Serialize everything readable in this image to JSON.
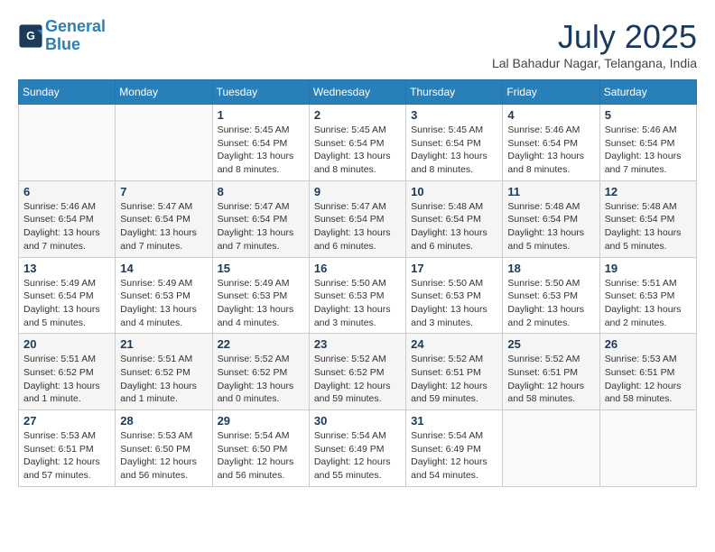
{
  "header": {
    "logo_line1": "General",
    "logo_line2": "Blue",
    "month_title": "July 2025",
    "location": "Lal Bahadur Nagar, Telangana, India"
  },
  "weekdays": [
    "Sunday",
    "Monday",
    "Tuesday",
    "Wednesday",
    "Thursday",
    "Friday",
    "Saturday"
  ],
  "weeks": [
    [
      {
        "day": "",
        "info": ""
      },
      {
        "day": "",
        "info": ""
      },
      {
        "day": "1",
        "info": "Sunrise: 5:45 AM\nSunset: 6:54 PM\nDaylight: 13 hours\nand 8 minutes."
      },
      {
        "day": "2",
        "info": "Sunrise: 5:45 AM\nSunset: 6:54 PM\nDaylight: 13 hours\nand 8 minutes."
      },
      {
        "day": "3",
        "info": "Sunrise: 5:45 AM\nSunset: 6:54 PM\nDaylight: 13 hours\nand 8 minutes."
      },
      {
        "day": "4",
        "info": "Sunrise: 5:46 AM\nSunset: 6:54 PM\nDaylight: 13 hours\nand 8 minutes."
      },
      {
        "day": "5",
        "info": "Sunrise: 5:46 AM\nSunset: 6:54 PM\nDaylight: 13 hours\nand 7 minutes."
      }
    ],
    [
      {
        "day": "6",
        "info": "Sunrise: 5:46 AM\nSunset: 6:54 PM\nDaylight: 13 hours\nand 7 minutes."
      },
      {
        "day": "7",
        "info": "Sunrise: 5:47 AM\nSunset: 6:54 PM\nDaylight: 13 hours\nand 7 minutes."
      },
      {
        "day": "8",
        "info": "Sunrise: 5:47 AM\nSunset: 6:54 PM\nDaylight: 13 hours\nand 7 minutes."
      },
      {
        "day": "9",
        "info": "Sunrise: 5:47 AM\nSunset: 6:54 PM\nDaylight: 13 hours\nand 6 minutes."
      },
      {
        "day": "10",
        "info": "Sunrise: 5:48 AM\nSunset: 6:54 PM\nDaylight: 13 hours\nand 6 minutes."
      },
      {
        "day": "11",
        "info": "Sunrise: 5:48 AM\nSunset: 6:54 PM\nDaylight: 13 hours\nand 5 minutes."
      },
      {
        "day": "12",
        "info": "Sunrise: 5:48 AM\nSunset: 6:54 PM\nDaylight: 13 hours\nand 5 minutes."
      }
    ],
    [
      {
        "day": "13",
        "info": "Sunrise: 5:49 AM\nSunset: 6:54 PM\nDaylight: 13 hours\nand 5 minutes."
      },
      {
        "day": "14",
        "info": "Sunrise: 5:49 AM\nSunset: 6:53 PM\nDaylight: 13 hours\nand 4 minutes."
      },
      {
        "day": "15",
        "info": "Sunrise: 5:49 AM\nSunset: 6:53 PM\nDaylight: 13 hours\nand 4 minutes."
      },
      {
        "day": "16",
        "info": "Sunrise: 5:50 AM\nSunset: 6:53 PM\nDaylight: 13 hours\nand 3 minutes."
      },
      {
        "day": "17",
        "info": "Sunrise: 5:50 AM\nSunset: 6:53 PM\nDaylight: 13 hours\nand 3 minutes."
      },
      {
        "day": "18",
        "info": "Sunrise: 5:50 AM\nSunset: 6:53 PM\nDaylight: 13 hours\nand 2 minutes."
      },
      {
        "day": "19",
        "info": "Sunrise: 5:51 AM\nSunset: 6:53 PM\nDaylight: 13 hours\nand 2 minutes."
      }
    ],
    [
      {
        "day": "20",
        "info": "Sunrise: 5:51 AM\nSunset: 6:52 PM\nDaylight: 13 hours\nand 1 minute."
      },
      {
        "day": "21",
        "info": "Sunrise: 5:51 AM\nSunset: 6:52 PM\nDaylight: 13 hours\nand 1 minute."
      },
      {
        "day": "22",
        "info": "Sunrise: 5:52 AM\nSunset: 6:52 PM\nDaylight: 13 hours\nand 0 minutes."
      },
      {
        "day": "23",
        "info": "Sunrise: 5:52 AM\nSunset: 6:52 PM\nDaylight: 12 hours\nand 59 minutes."
      },
      {
        "day": "24",
        "info": "Sunrise: 5:52 AM\nSunset: 6:51 PM\nDaylight: 12 hours\nand 59 minutes."
      },
      {
        "day": "25",
        "info": "Sunrise: 5:52 AM\nSunset: 6:51 PM\nDaylight: 12 hours\nand 58 minutes."
      },
      {
        "day": "26",
        "info": "Sunrise: 5:53 AM\nSunset: 6:51 PM\nDaylight: 12 hours\nand 58 minutes."
      }
    ],
    [
      {
        "day": "27",
        "info": "Sunrise: 5:53 AM\nSunset: 6:51 PM\nDaylight: 12 hours\nand 57 minutes."
      },
      {
        "day": "28",
        "info": "Sunrise: 5:53 AM\nSunset: 6:50 PM\nDaylight: 12 hours\nand 56 minutes."
      },
      {
        "day": "29",
        "info": "Sunrise: 5:54 AM\nSunset: 6:50 PM\nDaylight: 12 hours\nand 56 minutes."
      },
      {
        "day": "30",
        "info": "Sunrise: 5:54 AM\nSunset: 6:49 PM\nDaylight: 12 hours\nand 55 minutes."
      },
      {
        "day": "31",
        "info": "Sunrise: 5:54 AM\nSunset: 6:49 PM\nDaylight: 12 hours\nand 54 minutes."
      },
      {
        "day": "",
        "info": ""
      },
      {
        "day": "",
        "info": ""
      }
    ]
  ]
}
